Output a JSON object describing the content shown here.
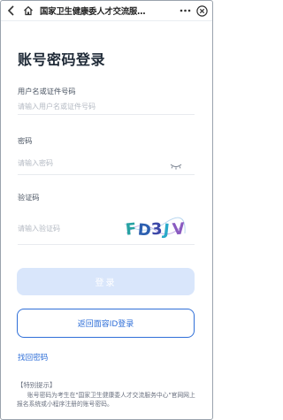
{
  "header": {
    "title": "国家卫生健康委人才交流服…",
    "back_icon": "chevron-left-icon",
    "home_icon": "home-icon",
    "more_icon": "more-dots-icon",
    "close_icon": "close-circle-icon"
  },
  "login": {
    "heading": "账号密码登录",
    "username_label": "用户名或证件号码",
    "username_placeholder": "请输入用户名或证件号码",
    "password_label": "密码",
    "password_placeholder": "请输入密码",
    "captcha_label": "验证码",
    "captcha_placeholder": "请输入验证码",
    "captcha_text": "FD3JV",
    "login_button": "登录",
    "face_button": "返回面容ID登录",
    "find_password": "找回密码"
  },
  "notice": {
    "title": "【特别提示】",
    "text": "账号密码为考生在\"国家卫生健康委人才交流服务中心\"官网网上报名系统或小程序注册的账号密码。"
  },
  "colors": {
    "accent": "#2f6fd8",
    "login_disabled": "#d9e6fb"
  }
}
